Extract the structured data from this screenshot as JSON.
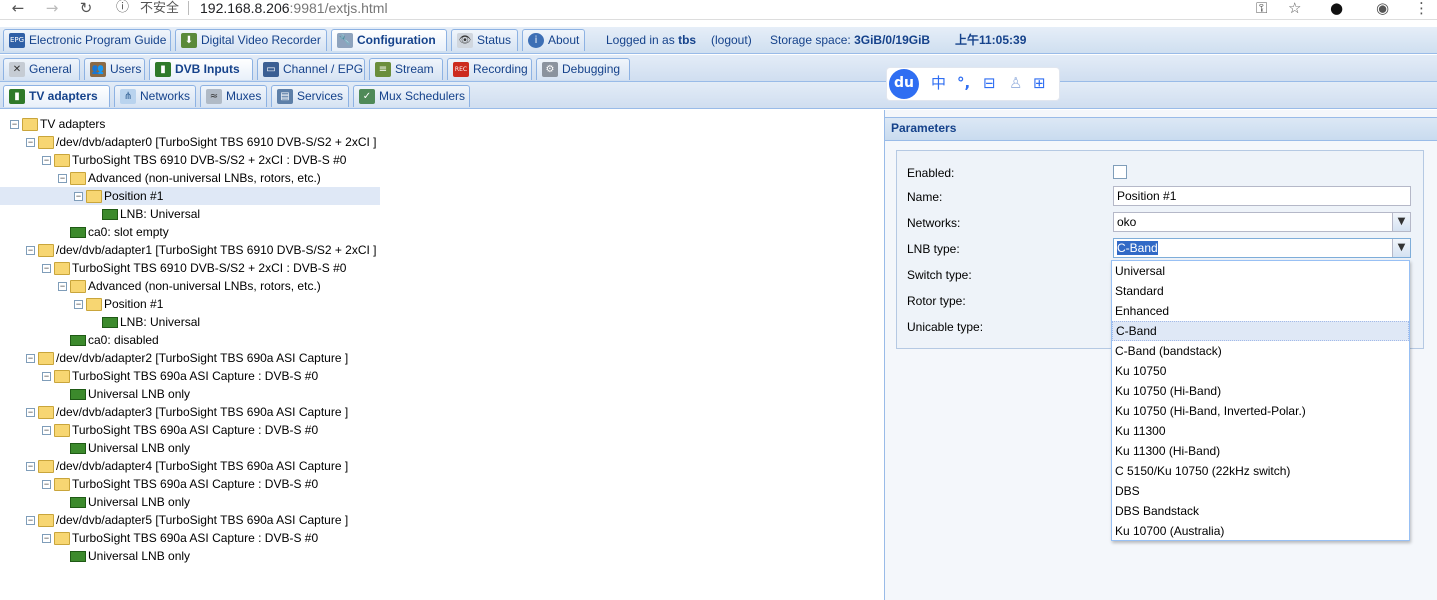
{
  "browser": {
    "insecure_label": "不安全",
    "url_host": "192.168.8.206",
    "url_rest": ":9981/extjs.html"
  },
  "top_tabs": [
    {
      "label": "Electronic Program Guide",
      "icon": "epg-icon"
    },
    {
      "label": "Digital Video Recorder",
      "icon": "download-icon"
    },
    {
      "label": "Configuration",
      "icon": "wrench-icon"
    },
    {
      "label": "Status",
      "icon": "eye-icon"
    },
    {
      "label": "About",
      "icon": "info-icon"
    }
  ],
  "header_info": {
    "logged_in_prefix": "Logged in as",
    "user": "tbs",
    "logout": "(logout)",
    "storage_prefix": "Storage space:",
    "storage_value": "3GiB/0/19GiB",
    "time": "上午11:05:39"
  },
  "config_tabs": [
    {
      "label": "General"
    },
    {
      "label": "Users"
    },
    {
      "label": "DVB Inputs"
    },
    {
      "label": "Channel / EPG"
    },
    {
      "label": "Stream"
    },
    {
      "label": "Recording"
    },
    {
      "label": "Debugging"
    }
  ],
  "dvb_tabs": [
    {
      "label": "TV adapters"
    },
    {
      "label": "Networks"
    },
    {
      "label": "Muxes"
    },
    {
      "label": "Services"
    },
    {
      "label": "Mux Schedulers"
    }
  ],
  "baidu_toolbar": {
    "logo": "du",
    "lang": "中",
    "punct": "°,"
  },
  "tree": [
    {
      "label": "TV adapters",
      "kind": "folder"
    },
    {
      "label": "/dev/dvb/adapter0 [TurboSight TBS 6910 DVB-S/S2 + 2xCI ]",
      "kind": "folder"
    },
    {
      "label": "TurboSight TBS 6910 DVB-S/S2 + 2xCI : DVB-S #0",
      "kind": "folder"
    },
    {
      "label": "Advanced (non-universal LNBs, rotors, etc.)",
      "kind": "folder"
    },
    {
      "label": "Position #1",
      "kind": "folder",
      "selected": true
    },
    {
      "label": "LNB: Universal",
      "kind": "card"
    },
    {
      "label": "ca0: slot empty",
      "kind": "card"
    },
    {
      "label": "/dev/dvb/adapter1 [TurboSight TBS 6910 DVB-S/S2 + 2xCI ]",
      "kind": "folder"
    },
    {
      "label": "TurboSight TBS 6910 DVB-S/S2 + 2xCI : DVB-S #0",
      "kind": "folder"
    },
    {
      "label": "Advanced (non-universal LNBs, rotors, etc.)",
      "kind": "folder"
    },
    {
      "label": "Position #1",
      "kind": "folder"
    },
    {
      "label": "LNB: Universal",
      "kind": "card"
    },
    {
      "label": "ca0: disabled",
      "kind": "card"
    },
    {
      "label": "/dev/dvb/adapter2 [TurboSight TBS 690a ASI Capture ]",
      "kind": "folder"
    },
    {
      "label": "TurboSight TBS 690a ASI Capture : DVB-S #0",
      "kind": "folder"
    },
    {
      "label": "Universal LNB only",
      "kind": "card"
    },
    {
      "label": "/dev/dvb/adapter3 [TurboSight TBS 690a ASI Capture ]",
      "kind": "folder"
    },
    {
      "label": "TurboSight TBS 690a ASI Capture : DVB-S #0",
      "kind": "folder"
    },
    {
      "label": "Universal LNB only",
      "kind": "card"
    },
    {
      "label": "/dev/dvb/adapter4 [TurboSight TBS 690a ASI Capture ]",
      "kind": "folder"
    },
    {
      "label": "TurboSight TBS 690a ASI Capture : DVB-S #0",
      "kind": "folder"
    },
    {
      "label": "Universal LNB only",
      "kind": "card"
    },
    {
      "label": "/dev/dvb/adapter5 [TurboSight TBS 690a ASI Capture ]",
      "kind": "folder"
    },
    {
      "label": "TurboSight TBS 690a ASI Capture : DVB-S #0",
      "kind": "folder"
    },
    {
      "label": "Universal LNB only",
      "kind": "card"
    }
  ],
  "params": {
    "title": "Parameters",
    "labels": {
      "enabled": "Enabled:",
      "name": "Name:",
      "networks": "Networks:",
      "lnb_type": "LNB type:",
      "switch_type": "Switch type:",
      "rotor_type": "Rotor type:",
      "unicable_type": "Unicable type:"
    },
    "values": {
      "enabled": false,
      "name": "Position #1",
      "networks": "oko",
      "lnb_type": "C-Band"
    }
  },
  "lnb_options": [
    "Universal",
    "Standard",
    "Enhanced",
    "C-Band",
    "C-Band (bandstack)",
    "Ku 10750",
    "Ku 10750 (Hi-Band)",
    "Ku 10750 (Hi-Band, Inverted-Polar.)",
    "Ku 11300",
    "Ku 11300 (Hi-Band)",
    "C 5150/Ku 10750 (22kHz switch)",
    "DBS",
    "DBS Bandstack",
    "Ku 10700 (Australia)"
  ],
  "lnb_hover_option": "C-Band"
}
